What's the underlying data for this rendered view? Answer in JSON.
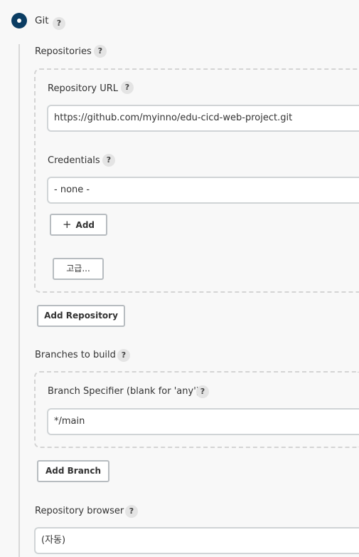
{
  "scm": {
    "git_label": "Git",
    "help_glyph": "?"
  },
  "repositories": {
    "label": "Repositories",
    "repo_url_label": "Repository URL",
    "repo_url_value": "https://github.com/myinno/edu-cicd-web-project.git",
    "credentials_label": "Credentials",
    "credentials_value": "- none -",
    "add_button_icon": "+",
    "add_button_label": "Add",
    "advanced_button_label": "고급...",
    "add_repository_button_label": "Add Repository"
  },
  "branches": {
    "label": "Branches to build",
    "specifier_label": "Branch Specifier (blank for 'any')",
    "specifier_value": "*/main",
    "add_branch_button_label": "Add Branch"
  },
  "browser": {
    "label": "Repository browser",
    "value": "(자동)"
  },
  "colors": {
    "radio_selected": "#0b3d63",
    "help_bg": "#e4e4e4",
    "border": "#d0d4d6"
  }
}
